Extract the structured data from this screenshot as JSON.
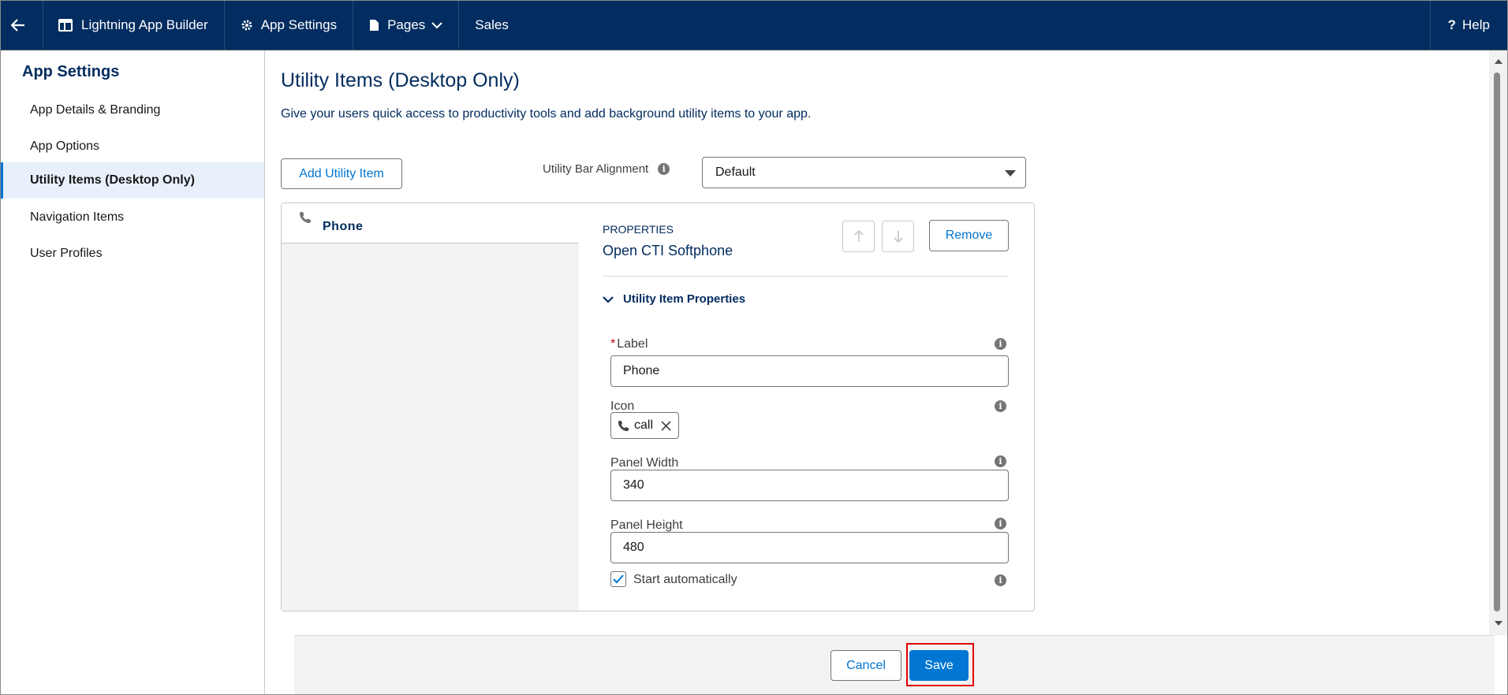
{
  "topbar": {
    "app_builder": "Lightning App Builder",
    "app_settings": "App Settings",
    "pages": "Pages",
    "app_name": "Sales",
    "help": "Help"
  },
  "sidebar": {
    "title": "App Settings",
    "items": [
      {
        "label": "App Details & Branding",
        "active": false
      },
      {
        "label": "App Options",
        "active": false
      },
      {
        "label": "Utility Items (Desktop Only)",
        "active": true
      },
      {
        "label": "Navigation Items",
        "active": false
      },
      {
        "label": "User Profiles",
        "active": false
      }
    ]
  },
  "main": {
    "title": "Utility Items (Desktop Only)",
    "description": "Give your users quick access to productivity tools and add background utility items to your app.",
    "add_button": "Add Utility Item",
    "alignment_label": "Utility Bar Alignment",
    "alignment_value": "Default"
  },
  "utility_list": [
    {
      "label": "Phone",
      "icon": "phone-icon"
    }
  ],
  "properties": {
    "heading": "PROPERTIES",
    "component": "Open CTI Softphone",
    "remove_button": "Remove",
    "section_title": "Utility Item Properties",
    "label_field": {
      "label": "Label",
      "required_mark": "*",
      "value": "Phone"
    },
    "icon_field": {
      "label": "Icon",
      "value": "call"
    },
    "panel_width": {
      "label": "Panel Width",
      "value": "340"
    },
    "panel_height": {
      "label": "Panel Height",
      "value": "480"
    },
    "start_automatically": {
      "label": "Start automatically",
      "checked": true
    }
  },
  "footer": {
    "cancel": "Cancel",
    "save": "Save"
  },
  "colors": {
    "brand_navy": "#032d60",
    "accent_blue": "#0176d3",
    "highlight_red": "#e00000"
  }
}
